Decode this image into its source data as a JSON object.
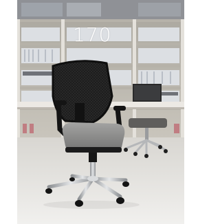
{
  "product": {
    "number": "170",
    "image_description_icon": "office-chair-photo"
  },
  "colors": {
    "wall": "#c7c2b8",
    "floor": "#e9e7e3",
    "chair_mesh": "#1a1a1a",
    "seat": "#8d8d8c",
    "chrome": "#b9bcbf",
    "label": "#ffffff"
  }
}
